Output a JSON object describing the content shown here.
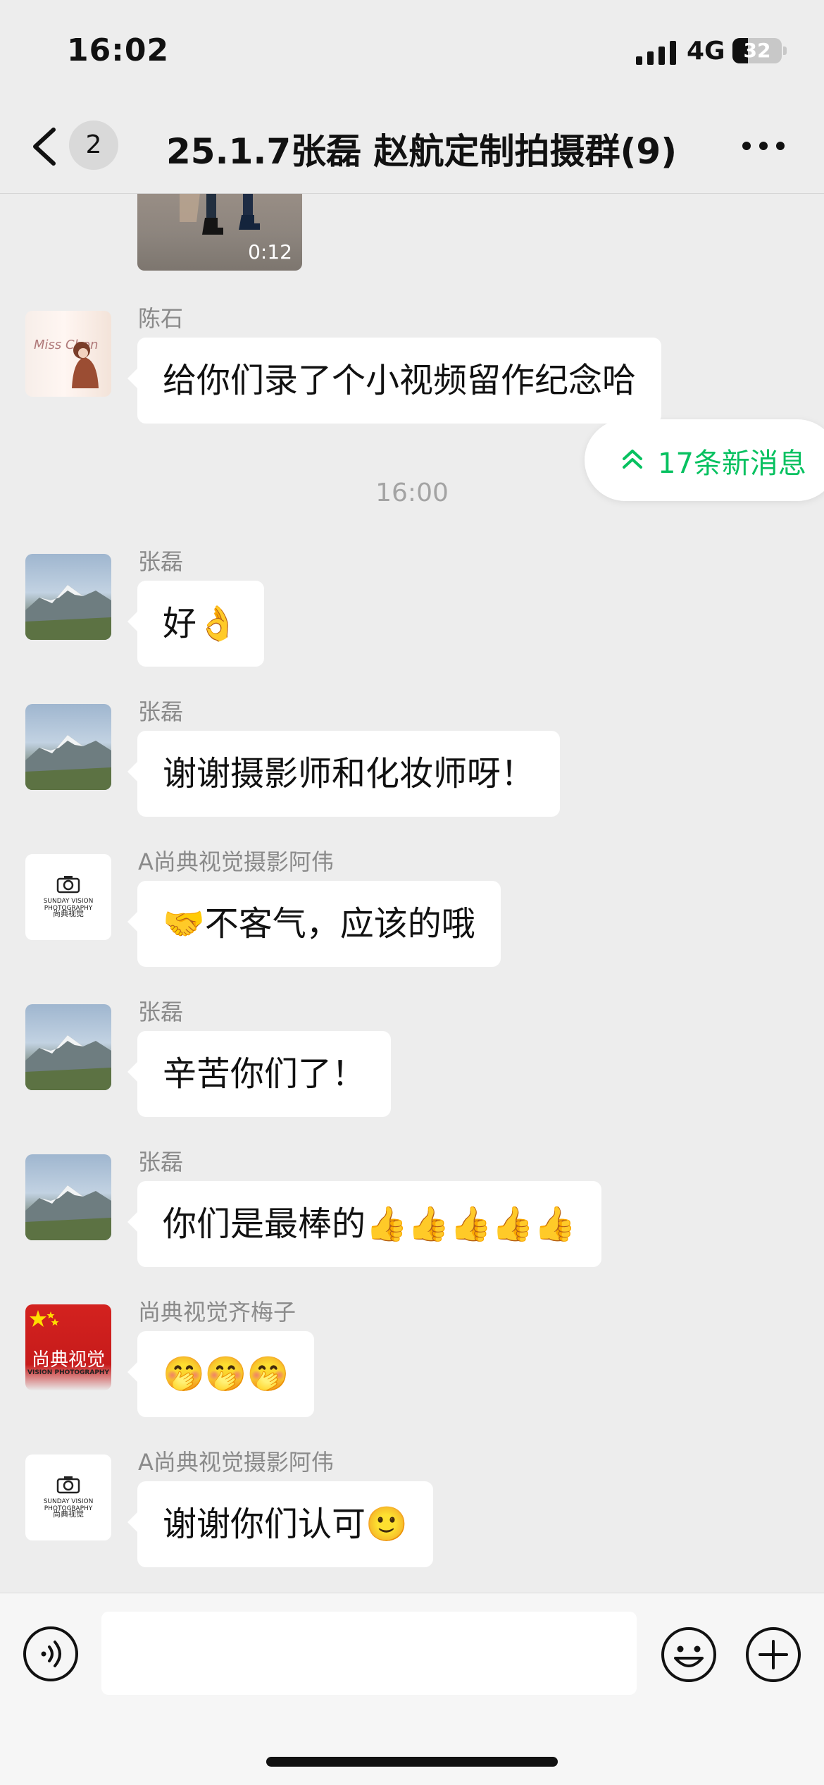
{
  "status_bar": {
    "time": "16:02",
    "network": "4G",
    "battery": "32",
    "battery_level": 0.32
  },
  "nav": {
    "unread_count": "2",
    "title": "25.1.7张磊 赵航定制拍摄群(9)"
  },
  "chat": {
    "video": {
      "duration": "0:12"
    },
    "new_messages": {
      "label": "17条新消息"
    },
    "timestamp": "16:00",
    "messages": [
      {
        "sender": "陈石",
        "text": "给你们录了个小视频留作纪念哈"
      },
      {
        "sender": "张磊",
        "text": "好👌"
      },
      {
        "sender": "张磊",
        "text": "谢谢摄影师和化妆师呀！"
      },
      {
        "sender": "A尚典视觉摄影阿伟",
        "text": "🤝不客气，应该的哦"
      },
      {
        "sender": "张磊",
        "text": "辛苦你们了！"
      },
      {
        "sender": "张磊",
        "text": "你们是最棒的👍👍👍👍👍"
      },
      {
        "sender": "尚典视觉齐梅子",
        "text": "🤭🤭🤭"
      },
      {
        "sender": "A尚典视觉摄影阿伟",
        "text": "谢谢你们认可🙂"
      }
    ]
  },
  "avatars": {
    "logo_brand": "SUNDAY VISION PHOTOGRAPHY",
    "logo_cn": "尚典视觉",
    "flag_cn": "尚典视觉",
    "flag_en": "VISION PHOTOGRAPHY",
    "chenshi_script": "Miss Chen"
  },
  "input": {
    "value": "",
    "placeholder": ""
  },
  "colors": {
    "accent": "#07c160",
    "bubble": "#ffffff",
    "background": "#ededed"
  }
}
